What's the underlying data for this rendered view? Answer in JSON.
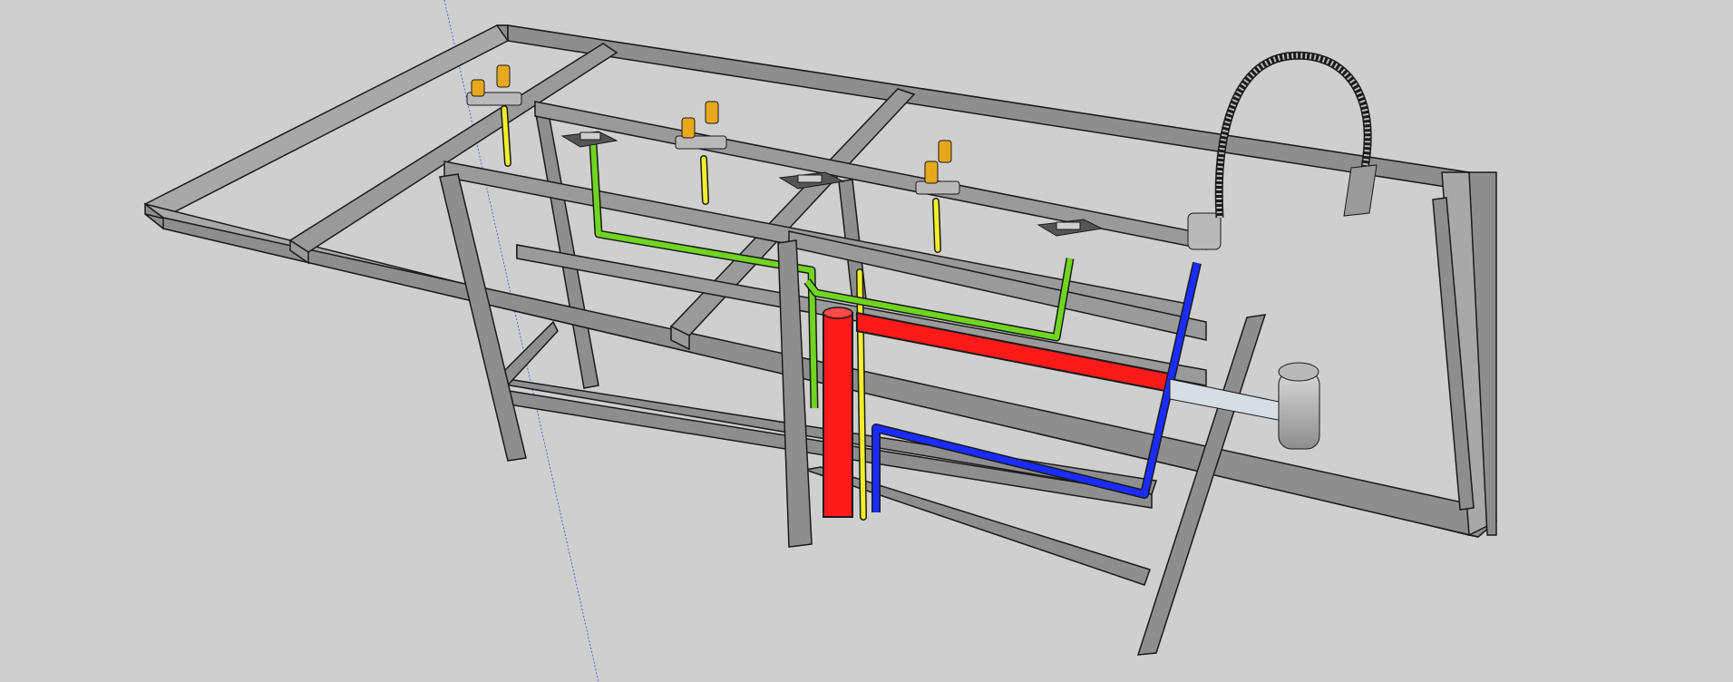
{
  "scene": {
    "background_color": "#cfcfcf",
    "frame_color": "#8e8e8e",
    "frame_top_color": "#a8a8a8",
    "frame_edge_color": "#1a1a1a",
    "pipe_colors": {
      "gas": "#f2ee2a",
      "compressed_air": "#6fd620",
      "drain": "#ff1a1a",
      "water": "#1a2cff"
    },
    "fitting_color": "#e8a81c",
    "outlet_color": "#555555",
    "faucet_color": "#b9b9b9",
    "icons": [
      "gas-valve-icon",
      "electrical-outlet-icon",
      "pull-down-faucet-icon",
      "sink-drain-trap-icon"
    ]
  }
}
